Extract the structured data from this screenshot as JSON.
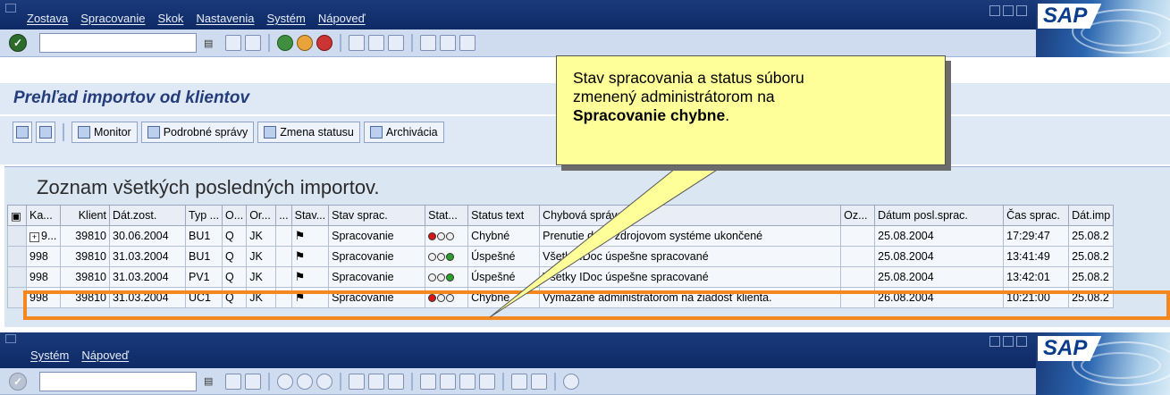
{
  "top_menu": [
    "Zostava",
    "Spracovanie",
    "Skok",
    "Nastavenia",
    "Systém",
    "Nápoveď"
  ],
  "brand": "SAP",
  "page_title": "Prehľad importov od klientov",
  "app_toolbar": {
    "monitor": "Monitor",
    "detail": "Podrobné správy",
    "change_status": "Zmena statusu",
    "archive": "Archivácia"
  },
  "list_title": "Zoznam všetkých posledných importov.",
  "columns": [
    "Ka...",
    "Klient",
    "Dát.zost.",
    "Typ ...",
    "O...",
    "Or...",
    "...",
    "Stav...",
    "Stav sprac.",
    "Stat...",
    "Status text",
    "Chybová správa",
    "Oz...",
    "Dátum posl.sprac.",
    "Čas sprac.",
    "Dát.imp"
  ],
  "rows": [
    {
      "ka": "9...",
      "klient": "39810",
      "dat": "30.06.2004",
      "typ": "BU1",
      "o": "Q",
      "or": "JK",
      "stav_sprac": "Spracovanie",
      "lights": [
        "red",
        "off",
        "off"
      ],
      "status_text": "Chybné",
      "sprava": "Prenutie dát v zdrojovom systéme ukončené",
      "datum": "25.08.2004",
      "cas": "17:29:47",
      "dat_imp": "25.08.2"
    },
    {
      "ka": "998",
      "klient": "39810",
      "dat": "31.03.2004",
      "typ": "BU1",
      "o": "Q",
      "or": "JK",
      "stav_sprac": "Spracovanie",
      "lights": [
        "off",
        "off",
        "green"
      ],
      "status_text": "Úspešné",
      "sprava": "Všetky IDoc úspešne spracované",
      "datum": "25.08.2004",
      "cas": "13:41:49",
      "dat_imp": "25.08.2"
    },
    {
      "ka": "998",
      "klient": "39810",
      "dat": "31.03.2004",
      "typ": "PV1",
      "o": "Q",
      "or": "JK",
      "stav_sprac": "Spracovanie",
      "lights": [
        "off",
        "off",
        "green"
      ],
      "status_text": "Úspešné",
      "sprava": "Všetky IDoc úspešne spracované",
      "datum": "25.08.2004",
      "cas": "13:42:01",
      "dat_imp": "25.08.2"
    },
    {
      "ka": "998",
      "klient": "39810",
      "dat": "31.03.2004",
      "typ": "UC1",
      "o": "Q",
      "or": "JK",
      "stav_sprac": "Spracovanie",
      "lights": [
        "red",
        "off",
        "off"
      ],
      "status_text": "Chybne",
      "sprava": "Vymazané administrátorom na žiadosť klienta.",
      "datum": "26.08.2004",
      "cas": "10:21:00",
      "dat_imp": "25.08.2"
    }
  ],
  "callout": {
    "line1": "Stav spracovania a status súboru",
    "line2": "zmenený administrátorom na",
    "bold": "Spracovanie chybne",
    "suffix": "."
  },
  "bottom_menu": [
    "Systém",
    "Nápoveď"
  ],
  "colors": {
    "sap_blue": "#0e2a66",
    "highlight": "#f4881f",
    "callout": "#ffff99"
  }
}
